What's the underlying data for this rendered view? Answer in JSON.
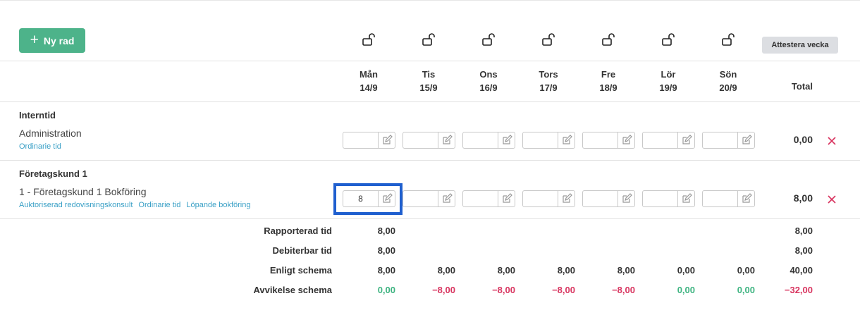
{
  "toolbar": {
    "new_row_label": "Ny rad",
    "attest_label": "Attestera vecka"
  },
  "days": [
    {
      "name": "Mån",
      "date": "14/9"
    },
    {
      "name": "Tis",
      "date": "15/9"
    },
    {
      "name": "Ons",
      "date": "16/9"
    },
    {
      "name": "Tors",
      "date": "17/9"
    },
    {
      "name": "Fre",
      "date": "18/9"
    },
    {
      "name": "Lör",
      "date": "19/9"
    },
    {
      "name": "Sön",
      "date": "20/9"
    }
  ],
  "total_header": "Total",
  "groups": [
    {
      "title": "Interntid",
      "row": {
        "title": "Administration",
        "tags": [
          "Ordinarie tid"
        ],
        "values": [
          "",
          "",
          "",
          "",
          "",
          "",
          ""
        ],
        "total": "0,00"
      }
    },
    {
      "title": "Företagskund 1",
      "row": {
        "title": "1 - Företagskund 1 Bokföring",
        "tags": [
          "Auktoriserad redovisningskonsult",
          "Ordinarie tid",
          "Löpande bokföring"
        ],
        "values": [
          "8",
          "",
          "",
          "",
          "",
          "",
          ""
        ],
        "total": "8,00"
      }
    }
  ],
  "summary": [
    {
      "label": "Rapporterad tid",
      "values": [
        "8,00",
        "",
        "",
        "",
        "",
        "",
        ""
      ],
      "total": "8,00"
    },
    {
      "label": "Debiterbar tid",
      "values": [
        "8,00",
        "",
        "",
        "",
        "",
        "",
        ""
      ],
      "total": "8,00"
    },
    {
      "label": "Enligt schema",
      "values": [
        "8,00",
        "8,00",
        "8,00",
        "8,00",
        "8,00",
        "0,00",
        "0,00"
      ],
      "total": "40,00"
    },
    {
      "label": "Avvikelse schema",
      "values": [
        "0,00",
        "−8,00",
        "−8,00",
        "−8,00",
        "−8,00",
        "0,00",
        "0,00"
      ],
      "total": "−32,00"
    }
  ],
  "colors": {
    "accent": "#4db38a",
    "positive": "#3db380",
    "negative": "#d8345f",
    "link": "#3aa0c6",
    "highlight": "#1f5fcf"
  },
  "icons": {
    "lock": "unlocked-padlock-icon",
    "edit": "edit-pencil-icon",
    "delete": "close-x-icon",
    "add": "plus-icon"
  }
}
